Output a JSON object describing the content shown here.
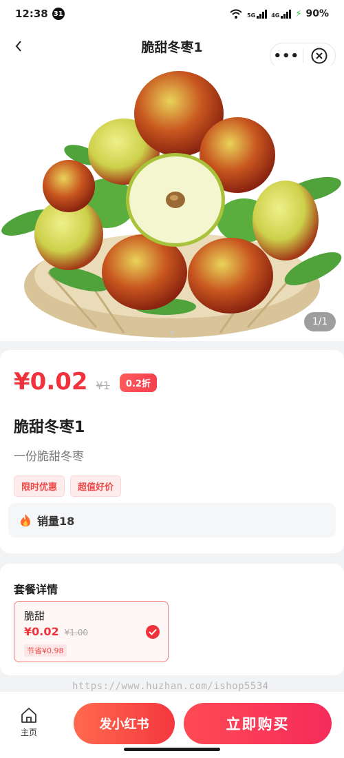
{
  "status_bar": {
    "time": "12:38",
    "calendar_badge": "31",
    "network_1": "5G",
    "network_2": "4G",
    "battery": "90%"
  },
  "nav": {
    "title": "脆甜冬枣1",
    "more_label": "•••"
  },
  "banner": {
    "image_counter": "1/1"
  },
  "product": {
    "price": "¥0.02",
    "original_price": "¥1",
    "discount": "0.2折",
    "title": "脆甜冬枣1",
    "description": "一份脆甜冬枣",
    "tags": [
      "限时优惠",
      "超值好价"
    ],
    "sales": "销量18"
  },
  "package": {
    "title": "套餐详情",
    "option": {
      "name": "脆甜",
      "price": "¥0.02",
      "original_price": "¥1.00",
      "saving": "节省¥0.98",
      "selected": true
    }
  },
  "watermark": "https://www.huzhan.com/ishop5534",
  "bottom_bar": {
    "home_label": "主页",
    "xhs_button": "发小红书",
    "buy_button": "立即购买"
  },
  "colors": {
    "accent": "#f0323d",
    "tag_bg": "#fdecec"
  }
}
